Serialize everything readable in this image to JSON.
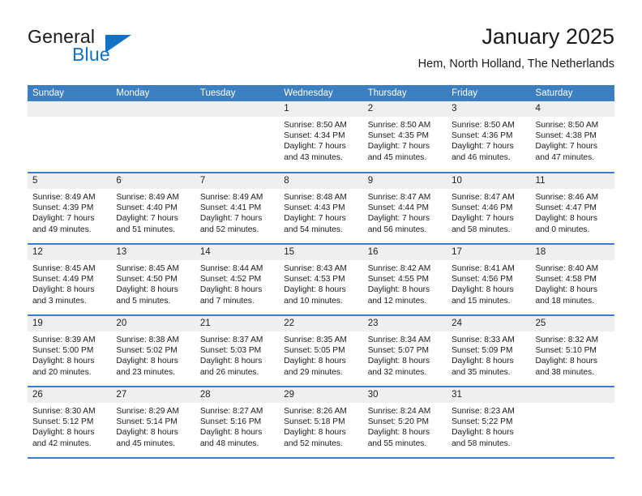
{
  "brand": {
    "word1": "General",
    "word2": "Blue",
    "accent_color": "#1273c6"
  },
  "header": {
    "month_title": "January 2025",
    "location": "Hem, North Holland, The Netherlands"
  },
  "calendar": {
    "header_bg": "#3c7fc1",
    "daynum_bg": "#efefef",
    "day_names": [
      "Sunday",
      "Monday",
      "Tuesday",
      "Wednesday",
      "Thursday",
      "Friday",
      "Saturday"
    ],
    "weeks": [
      [
        {
          "day": "",
          "empty": true
        },
        {
          "day": "",
          "empty": true
        },
        {
          "day": "",
          "empty": true
        },
        {
          "day": "1",
          "sunrise": "Sunrise: 8:50 AM",
          "sunset": "Sunset: 4:34 PM",
          "daylight_line1": "Daylight: 7 hours",
          "daylight_line2": "and 43 minutes."
        },
        {
          "day": "2",
          "sunrise": "Sunrise: 8:50 AM",
          "sunset": "Sunset: 4:35 PM",
          "daylight_line1": "Daylight: 7 hours",
          "daylight_line2": "and 45 minutes."
        },
        {
          "day": "3",
          "sunrise": "Sunrise: 8:50 AM",
          "sunset": "Sunset: 4:36 PM",
          "daylight_line1": "Daylight: 7 hours",
          "daylight_line2": "and 46 minutes."
        },
        {
          "day": "4",
          "sunrise": "Sunrise: 8:50 AM",
          "sunset": "Sunset: 4:38 PM",
          "daylight_line1": "Daylight: 7 hours",
          "daylight_line2": "and 47 minutes."
        }
      ],
      [
        {
          "day": "5",
          "sunrise": "Sunrise: 8:49 AM",
          "sunset": "Sunset: 4:39 PM",
          "daylight_line1": "Daylight: 7 hours",
          "daylight_line2": "and 49 minutes."
        },
        {
          "day": "6",
          "sunrise": "Sunrise: 8:49 AM",
          "sunset": "Sunset: 4:40 PM",
          "daylight_line1": "Daylight: 7 hours",
          "daylight_line2": "and 51 minutes."
        },
        {
          "day": "7",
          "sunrise": "Sunrise: 8:49 AM",
          "sunset": "Sunset: 4:41 PM",
          "daylight_line1": "Daylight: 7 hours",
          "daylight_line2": "and 52 minutes."
        },
        {
          "day": "8",
          "sunrise": "Sunrise: 8:48 AM",
          "sunset": "Sunset: 4:43 PM",
          "daylight_line1": "Daylight: 7 hours",
          "daylight_line2": "and 54 minutes."
        },
        {
          "day": "9",
          "sunrise": "Sunrise: 8:47 AM",
          "sunset": "Sunset: 4:44 PM",
          "daylight_line1": "Daylight: 7 hours",
          "daylight_line2": "and 56 minutes."
        },
        {
          "day": "10",
          "sunrise": "Sunrise: 8:47 AM",
          "sunset": "Sunset: 4:46 PM",
          "daylight_line1": "Daylight: 7 hours",
          "daylight_line2": "and 58 minutes."
        },
        {
          "day": "11",
          "sunrise": "Sunrise: 8:46 AM",
          "sunset": "Sunset: 4:47 PM",
          "daylight_line1": "Daylight: 8 hours",
          "daylight_line2": "and 0 minutes."
        }
      ],
      [
        {
          "day": "12",
          "sunrise": "Sunrise: 8:45 AM",
          "sunset": "Sunset: 4:49 PM",
          "daylight_line1": "Daylight: 8 hours",
          "daylight_line2": "and 3 minutes."
        },
        {
          "day": "13",
          "sunrise": "Sunrise: 8:45 AM",
          "sunset": "Sunset: 4:50 PM",
          "daylight_line1": "Daylight: 8 hours",
          "daylight_line2": "and 5 minutes."
        },
        {
          "day": "14",
          "sunrise": "Sunrise: 8:44 AM",
          "sunset": "Sunset: 4:52 PM",
          "daylight_line1": "Daylight: 8 hours",
          "daylight_line2": "and 7 minutes."
        },
        {
          "day": "15",
          "sunrise": "Sunrise: 8:43 AM",
          "sunset": "Sunset: 4:53 PM",
          "daylight_line1": "Daylight: 8 hours",
          "daylight_line2": "and 10 minutes."
        },
        {
          "day": "16",
          "sunrise": "Sunrise: 8:42 AM",
          "sunset": "Sunset: 4:55 PM",
          "daylight_line1": "Daylight: 8 hours",
          "daylight_line2": "and 12 minutes."
        },
        {
          "day": "17",
          "sunrise": "Sunrise: 8:41 AM",
          "sunset": "Sunset: 4:56 PM",
          "daylight_line1": "Daylight: 8 hours",
          "daylight_line2": "and 15 minutes."
        },
        {
          "day": "18",
          "sunrise": "Sunrise: 8:40 AM",
          "sunset": "Sunset: 4:58 PM",
          "daylight_line1": "Daylight: 8 hours",
          "daylight_line2": "and 18 minutes."
        }
      ],
      [
        {
          "day": "19",
          "sunrise": "Sunrise: 8:39 AM",
          "sunset": "Sunset: 5:00 PM",
          "daylight_line1": "Daylight: 8 hours",
          "daylight_line2": "and 20 minutes."
        },
        {
          "day": "20",
          "sunrise": "Sunrise: 8:38 AM",
          "sunset": "Sunset: 5:02 PM",
          "daylight_line1": "Daylight: 8 hours",
          "daylight_line2": "and 23 minutes."
        },
        {
          "day": "21",
          "sunrise": "Sunrise: 8:37 AM",
          "sunset": "Sunset: 5:03 PM",
          "daylight_line1": "Daylight: 8 hours",
          "daylight_line2": "and 26 minutes."
        },
        {
          "day": "22",
          "sunrise": "Sunrise: 8:35 AM",
          "sunset": "Sunset: 5:05 PM",
          "daylight_line1": "Daylight: 8 hours",
          "daylight_line2": "and 29 minutes."
        },
        {
          "day": "23",
          "sunrise": "Sunrise: 8:34 AM",
          "sunset": "Sunset: 5:07 PM",
          "daylight_line1": "Daylight: 8 hours",
          "daylight_line2": "and 32 minutes."
        },
        {
          "day": "24",
          "sunrise": "Sunrise: 8:33 AM",
          "sunset": "Sunset: 5:09 PM",
          "daylight_line1": "Daylight: 8 hours",
          "daylight_line2": "and 35 minutes."
        },
        {
          "day": "25",
          "sunrise": "Sunrise: 8:32 AM",
          "sunset": "Sunset: 5:10 PM",
          "daylight_line1": "Daylight: 8 hours",
          "daylight_line2": "and 38 minutes."
        }
      ],
      [
        {
          "day": "26",
          "sunrise": "Sunrise: 8:30 AM",
          "sunset": "Sunset: 5:12 PM",
          "daylight_line1": "Daylight: 8 hours",
          "daylight_line2": "and 42 minutes."
        },
        {
          "day": "27",
          "sunrise": "Sunrise: 8:29 AM",
          "sunset": "Sunset: 5:14 PM",
          "daylight_line1": "Daylight: 8 hours",
          "daylight_line2": "and 45 minutes."
        },
        {
          "day": "28",
          "sunrise": "Sunrise: 8:27 AM",
          "sunset": "Sunset: 5:16 PM",
          "daylight_line1": "Daylight: 8 hours",
          "daylight_line2": "and 48 minutes."
        },
        {
          "day": "29",
          "sunrise": "Sunrise: 8:26 AM",
          "sunset": "Sunset: 5:18 PM",
          "daylight_line1": "Daylight: 8 hours",
          "daylight_line2": "and 52 minutes."
        },
        {
          "day": "30",
          "sunrise": "Sunrise: 8:24 AM",
          "sunset": "Sunset: 5:20 PM",
          "daylight_line1": "Daylight: 8 hours",
          "daylight_line2": "and 55 minutes."
        },
        {
          "day": "31",
          "sunrise": "Sunrise: 8:23 AM",
          "sunset": "Sunset: 5:22 PM",
          "daylight_line1": "Daylight: 8 hours",
          "daylight_line2": "and 58 minutes."
        },
        {
          "day": "",
          "empty": true
        }
      ]
    ]
  }
}
